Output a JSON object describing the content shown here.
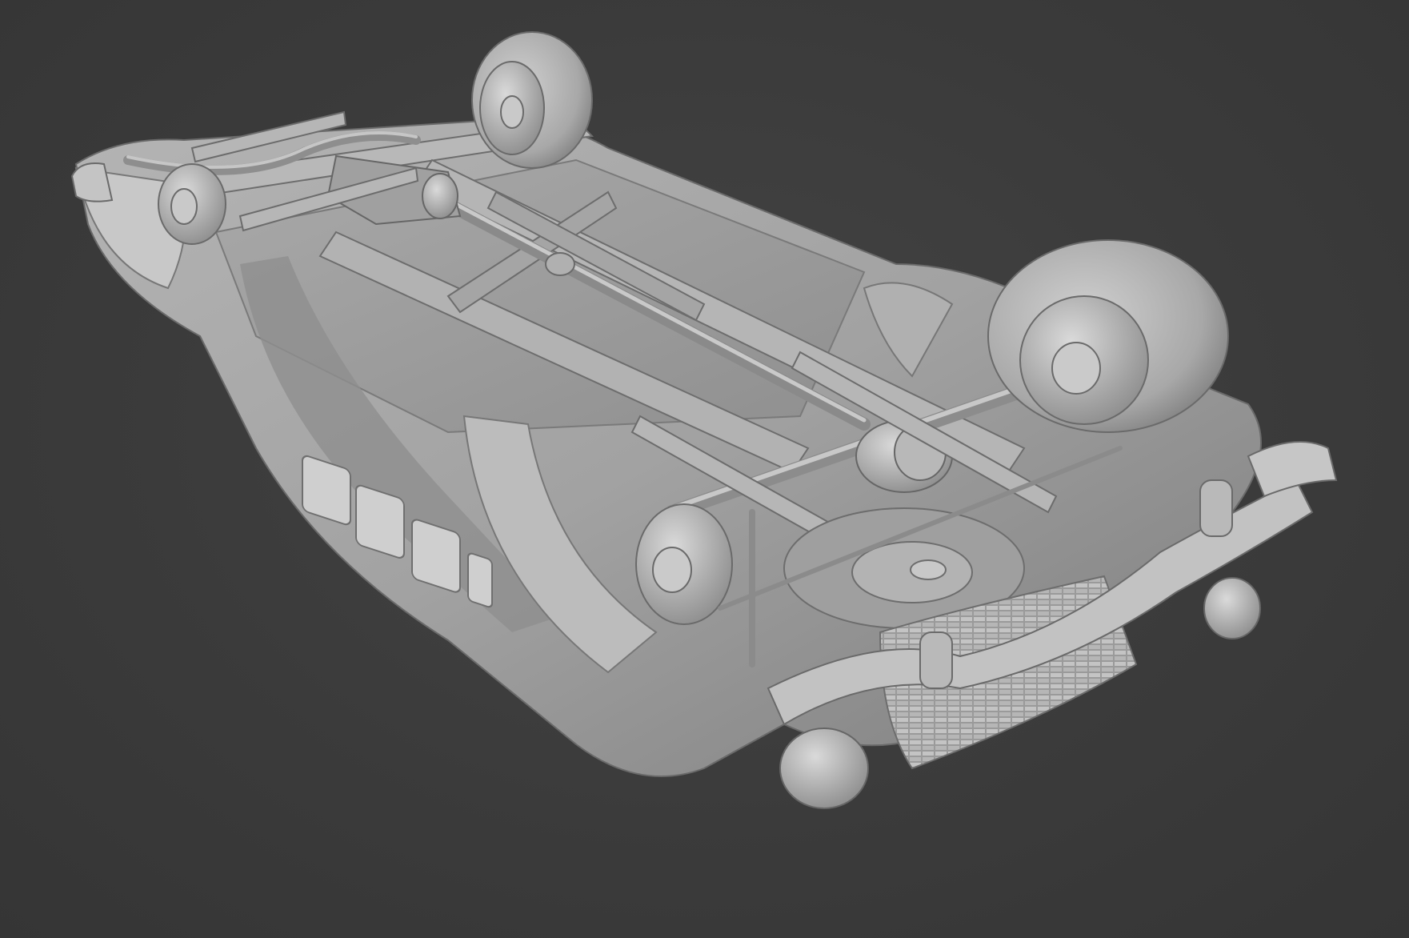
{
  "viewport": {
    "background_color": "#3a3a3a",
    "model_color": "#a6a6a6",
    "model_shadow_color": "#6e6e6e",
    "model_highlight_color": "#d2d2d2"
  },
  "model": {
    "subject": "car-underside-clay-render",
    "parts": [
      "body-shell",
      "chassis-frame",
      "drive-shaft",
      "rear-axle",
      "differential",
      "front-wheel-left",
      "front-wheel-right",
      "rear-wheel-left",
      "rear-wheel-right",
      "leaf-springs",
      "front-bumper",
      "rear-bumper",
      "grille",
      "exhaust-pipe",
      "side-windows"
    ]
  }
}
